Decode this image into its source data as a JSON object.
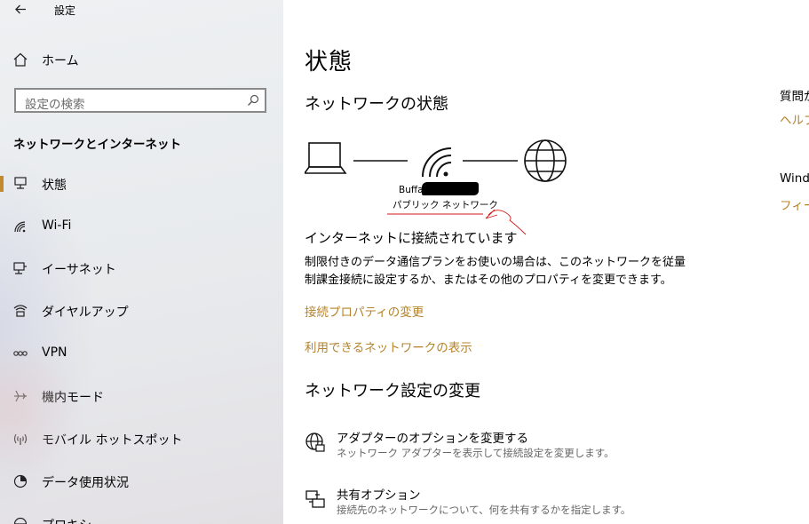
{
  "window": {
    "title": "設定"
  },
  "sidebar": {
    "home_label": "ホーム",
    "search_placeholder": "設定の検索",
    "section_title": "ネットワークとインターネット",
    "items": [
      {
        "label": "状態",
        "icon": "status-icon",
        "selected": true
      },
      {
        "label": "Wi-Fi",
        "icon": "wifi-icon"
      },
      {
        "label": "イーサネット",
        "icon": "ethernet-icon"
      },
      {
        "label": "ダイヤルアップ",
        "icon": "dialup-icon"
      },
      {
        "label": "VPN",
        "icon": "vpn-icon"
      },
      {
        "label": "機内モード",
        "icon": "airplane-icon"
      },
      {
        "label": "モバイル ホットスポット",
        "icon": "hotspot-icon"
      },
      {
        "label": "データ使用状況",
        "icon": "data-usage-icon"
      },
      {
        "label": "プロキシ",
        "icon": "proxy-icon"
      }
    ]
  },
  "main": {
    "page_title": "状態",
    "network_status_heading": "ネットワークの状態",
    "network_name": "Buffal",
    "network_type": "パブリック ネットワーク",
    "connected_text": "インターネットに接続されています",
    "description_line1": "制限付きのデータ通信プランをお使いの場合は、このネットワークを従量",
    "description_line2": "制課金接続に設定するか、またはその他のプロパティを変更できます。",
    "link_connection_properties": "接続プロパティの変更",
    "link_show_networks": "利用できるネットワークの表示",
    "change_settings_heading": "ネットワーク設定の変更",
    "options": [
      {
        "title": "アダプターのオプションを変更する",
        "subtitle": "ネットワーク アダプターを表示して接続設定を変更します。",
        "icon": "adapter-icon"
      },
      {
        "title": "共有オプション",
        "subtitle": "接続先のネットワークについて、何を共有するかを指定します。",
        "icon": "sharing-icon"
      }
    ]
  },
  "right_panel": {
    "question_heading": "質問が",
    "help_link": "ヘルプ",
    "windows_heading": "Windo",
    "feedback_link": "フィード"
  },
  "colors": {
    "accent": "#b5832c",
    "selected_bar": "#c18a2d",
    "annotation": "#d11a1a"
  }
}
